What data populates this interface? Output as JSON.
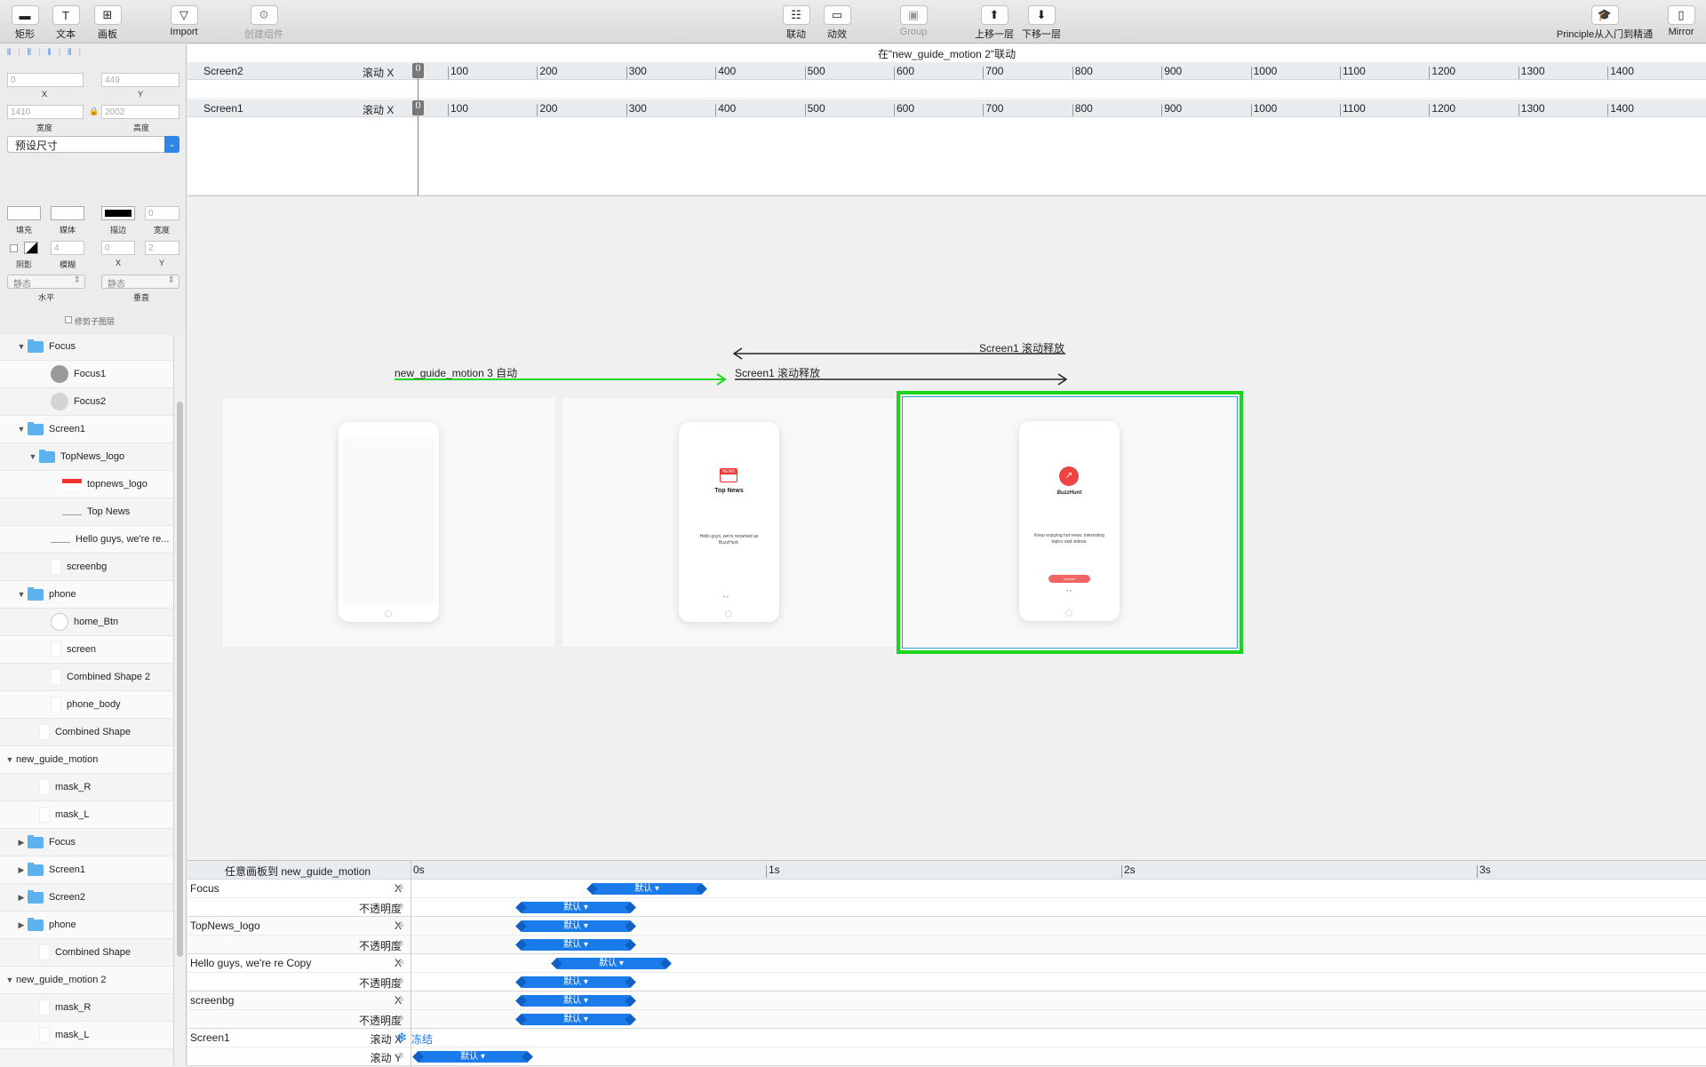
{
  "toolbar": {
    "left": [
      {
        "label": "矩形",
        "icon": "rectangle-icon"
      },
      {
        "label": "文本",
        "icon": "text-icon"
      },
      {
        "label": "画板",
        "icon": "artboard-icon"
      },
      {
        "label": "Import",
        "icon": "import-icon"
      },
      {
        "label": "创建组件",
        "icon": "component-icon"
      }
    ],
    "center": [
      {
        "label": "联动",
        "icon": "drivers-icon"
      },
      {
        "label": "动效",
        "icon": "animate-icon"
      },
      {
        "label": "Group",
        "icon": "group-icon"
      },
      {
        "label": "上移一层",
        "icon": "bring-forward-icon"
      },
      {
        "label": "下移一层",
        "icon": "send-backward-icon"
      }
    ],
    "right": [
      {
        "label": "Principle从入门到精通",
        "icon": "graduation-cap-icon"
      },
      {
        "label": "Mirror",
        "icon": "mirror-icon"
      }
    ]
  },
  "inspector": {
    "x_value": "0",
    "y_value": "449",
    "x_label": "X",
    "y_label": "Y",
    "w_value": "1410",
    "h_value": "2002",
    "w_label": "宽度",
    "h_label": "高度",
    "preset": "预设尺寸",
    "fill_label": "填充",
    "media_label": "媒体",
    "stroke_label": "描边",
    "stroke_width_value": "0",
    "stroke_width_label": "宽度",
    "shadow_label": "阴影",
    "blur_label": "模糊",
    "blur_value": "4",
    "sx_value": "0",
    "sy_value": "2",
    "sx_label": "X",
    "sy_label": "Y",
    "h_mode": "静态",
    "v_mode": "静态",
    "h_mode_label": "水平",
    "v_mode_label": "垂直",
    "clip_label": "修剪子图层"
  },
  "layers": [
    {
      "name": "Focus",
      "indent": 1,
      "type": "folder",
      "open": true
    },
    {
      "name": "Focus1",
      "indent": 3,
      "type": "circle-dark"
    },
    {
      "name": "Focus2",
      "indent": 3,
      "type": "circle-light"
    },
    {
      "name": "Screen1",
      "indent": 1,
      "type": "folder",
      "open": true
    },
    {
      "name": "TopNews_logo",
      "indent": 2,
      "type": "folder",
      "open": true
    },
    {
      "name": "topnews_logo",
      "indent": 4,
      "type": "news"
    },
    {
      "name": "Top News",
      "indent": 4,
      "type": "text"
    },
    {
      "name": "Hello guys, we're re...",
      "indent": 3,
      "type": "text"
    },
    {
      "name": "screenbg",
      "indent": 3,
      "type": "rect"
    },
    {
      "name": "phone",
      "indent": 1,
      "type": "folder",
      "open": true
    },
    {
      "name": "home_Btn",
      "indent": 3,
      "type": "circle-outline"
    },
    {
      "name": "screen",
      "indent": 3,
      "type": "rect"
    },
    {
      "name": "Combined Shape 2",
      "indent": 3,
      "type": "rect"
    },
    {
      "name": "phone_body",
      "indent": 3,
      "type": "rect"
    },
    {
      "name": "Combined Shape",
      "indent": 2,
      "type": "rect"
    },
    {
      "name": "new_guide_motion",
      "indent": 0,
      "type": "none",
      "open": true
    },
    {
      "name": "mask_R",
      "indent": 2,
      "type": "rect"
    },
    {
      "name": "mask_L",
      "indent": 2,
      "type": "rect"
    },
    {
      "name": "Focus",
      "indent": 1,
      "type": "folder",
      "open": false
    },
    {
      "name": "Screen1",
      "indent": 1,
      "type": "folder",
      "open": false
    },
    {
      "name": "Screen2",
      "indent": 1,
      "type": "folder",
      "open": false
    },
    {
      "name": "phone",
      "indent": 1,
      "type": "folder",
      "open": false
    },
    {
      "name": "Combined Shape",
      "indent": 2,
      "type": "rect"
    },
    {
      "name": "new_guide_motion 2",
      "indent": 0,
      "type": "none",
      "open": true
    },
    {
      "name": "mask_R",
      "indent": 2,
      "type": "rect"
    },
    {
      "name": "mask_L",
      "indent": 2,
      "type": "rect"
    }
  ],
  "driver": {
    "title": "在\"new_guide_motion 2\"联动",
    "rows": [
      {
        "name": "Screen2",
        "prop": "滚动 X",
        "playhead": "0"
      },
      {
        "name": "Screen1",
        "prop": "滚动 X",
        "playhead": "0"
      }
    ],
    "ruler": [
      "100",
      "200",
      "300",
      "400",
      "500",
      "600",
      "700",
      "800",
      "900",
      "1000",
      "1100",
      "1200",
      "1300",
      "1400"
    ]
  },
  "canvas": {
    "arrow_auto_label": "new_guide_motion 3 自动",
    "arrow_release_back_label": "Screen1 滚动释放",
    "arrow_release_fwd_label": "Screen1 滚动释放",
    "artboard2": {
      "app_title": "Top News",
      "badge": "NEWS",
      "body": "Hello guys, we're renamed as BuzzHunt."
    },
    "artboard3": {
      "app_title": "BuzzHunt",
      "body": "Keep enjoying hot news, interesting topics and videos.",
      "button": "Explore"
    }
  },
  "animation": {
    "header": "任意画板到 new_guide_motion",
    "ruler": [
      "0s",
      "1s",
      "2s",
      "3s"
    ],
    "rows": [
      {
        "name": "Focus",
        "prop": "X",
        "bar": "默认 ▾",
        "start": 0.49,
        "end": 0.82
      },
      {
        "name": "",
        "prop": "不透明度",
        "bar": "默认 ▾",
        "start": 0.29,
        "end": 0.62
      },
      {
        "name": "TopNews_logo",
        "prop": "X",
        "bar": "默认 ▾",
        "start": 0.29,
        "end": 0.62
      },
      {
        "name": "",
        "prop": "不透明度",
        "bar": "默认 ▾",
        "start": 0.29,
        "end": 0.62
      },
      {
        "name": "Hello guys, we're re Copy",
        "prop": "X",
        "bar": "默认 ▾",
        "start": 0.39,
        "end": 0.72
      },
      {
        "name": "",
        "prop": "不透明度",
        "bar": "默认 ▾",
        "start": 0.29,
        "end": 0.62
      },
      {
        "name": "screenbg",
        "prop": "X",
        "bar": "默认 ▾",
        "start": 0.29,
        "end": 0.62
      },
      {
        "name": "",
        "prop": "不透明度",
        "bar": "默认 ▾",
        "start": 0.29,
        "end": 0.62
      },
      {
        "name": "Screen1",
        "prop": "滚动 X",
        "frozen": "冻结"
      },
      {
        "name": "",
        "prop": "滚动 Y",
        "bar": "默认 ▾",
        "start": 0.0,
        "end": 0.33
      }
    ]
  }
}
